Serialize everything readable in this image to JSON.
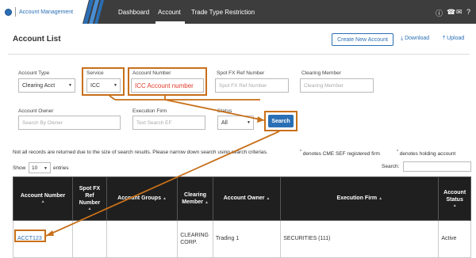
{
  "app": {
    "title": "Account Management"
  },
  "nav": {
    "items": [
      {
        "label": "Dashboard"
      },
      {
        "label": "Account"
      },
      {
        "label": "Trade Type Restriction"
      }
    ],
    "icons": [
      "info-icon",
      "phone-icon",
      "mail-icon",
      "help-icon"
    ]
  },
  "header": {
    "title": "Account List",
    "create_label": "Create New Account",
    "download_label": "Download",
    "upload_label": "Upload"
  },
  "filters": {
    "account_type": {
      "label": "Account Type",
      "value": "Clearing Acct"
    },
    "service": {
      "label": "Service",
      "value": "ICC"
    },
    "account_number": {
      "label": "Account Number",
      "value": "ICC Account number"
    },
    "spot_fx": {
      "label": "Spot FX Ref Number",
      "placeholder": "Spot FX Ref Number"
    },
    "clearing_member": {
      "label": "Clearing Member",
      "placeholder": "Clearing Member"
    },
    "account_owner": {
      "label": "Account Owner",
      "placeholder": "Search By Owner"
    },
    "execution_firm": {
      "label": "Execution Firm",
      "placeholder": "Text Search EF"
    },
    "status": {
      "label": "Status",
      "value": "All"
    },
    "search_label": "Search"
  },
  "notice": {
    "text": "Not all records are returned due to the size of search results. Please narrow down search using search criterias.",
    "legend_cme": "denotes CME SEF registered firm",
    "legend_holding": "denotes holding account"
  },
  "table_controls": {
    "show_label": "Show",
    "page_size": "10",
    "entries_label": "entries",
    "search_label": "Search:"
  },
  "table": {
    "columns": [
      "Account Number",
      "Spot FX Ref Number",
      "Account Groups",
      "Clearing Member",
      "Account Owner",
      "Execution Firm",
      "Account Status"
    ],
    "rows": [
      {
        "account_number": "ACCT123",
        "spot_fx": "",
        "groups": "",
        "clearing_member": "CLEARING CORP.",
        "owner": "Trading 1",
        "execution_firm": "SECURITIES (111)",
        "status": "Active"
      }
    ]
  },
  "colors": {
    "topbar": "#3d3d3d",
    "accent": "#2a6fb5",
    "highlight": "#c8701a",
    "table_header": "#1f1f1f"
  }
}
